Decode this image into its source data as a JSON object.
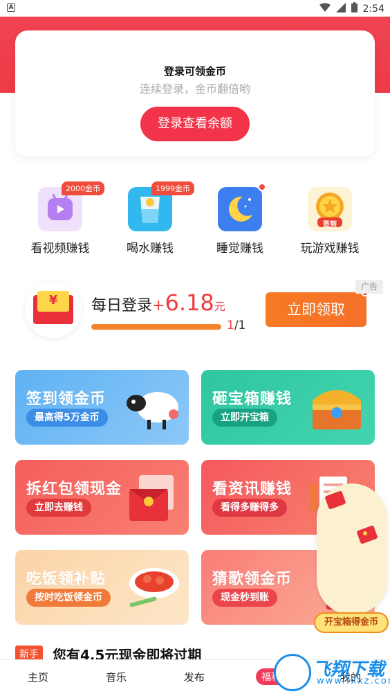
{
  "status_bar": {
    "time": "2:54",
    "left_icon": "A"
  },
  "login_card": {
    "title": "登录可领金币",
    "subtitle": "连续登录，金币翻倍哟",
    "button": "登录查看余额"
  },
  "quick_actions": [
    {
      "label": "看视频赚钱",
      "badge": "2000金币",
      "icon": "video-icon",
      "color": "#c9a2f5"
    },
    {
      "label": "喝水赚钱",
      "badge": "1999金币",
      "icon": "water-glass-icon",
      "color": "#4cc4f2"
    },
    {
      "label": "睡觉赚钱",
      "badge": "",
      "icon": "moon-icon",
      "color": "#4b83ee"
    },
    {
      "label": "玩游戏赚钱",
      "badge": "",
      "icon": "game-coin-icon",
      "color": "#f6a623",
      "icon_text": "签到"
    }
  ],
  "daily": {
    "title": "每日登录",
    "plus": "+",
    "amount": "6.18",
    "unit": "元",
    "progress_num": "1",
    "progress_den": "/1",
    "progress": 1.0,
    "button": "立即领取",
    "ad_tag": "广告",
    "envelope_symbol": "¥"
  },
  "cards": [
    {
      "title": "签到领金币",
      "sub": "最高得5万金币",
      "art": "sheep-icon"
    },
    {
      "title": "砸宝箱赚钱",
      "sub": "立即开宝箱",
      "art": "treasure-chest-icon"
    },
    {
      "title": "拆红包领现金",
      "sub": "立即去赚钱",
      "art": "red-envelope-icon"
    },
    {
      "title": "看资讯赚钱",
      "sub": "看得多赚得多",
      "art": "news-icon"
    },
    {
      "title": "吃饭领补贴",
      "sub": "按时吃饭领金币",
      "art": "food-plate-icon"
    },
    {
      "title": "猜歌领金币",
      "sub": "现金秒到账",
      "art": "gift-box-icon"
    }
  ],
  "floating": {
    "label": "开宝箱得金币"
  },
  "new_user": {
    "tag": "新手",
    "text": "您有4.5元现金即将过期"
  },
  "nav": [
    {
      "label": "主页"
    },
    {
      "label": "音乐"
    },
    {
      "label": "发布"
    },
    {
      "label": "福利"
    },
    {
      "label": "我的"
    }
  ],
  "watermark": {
    "title": "飞翔下载",
    "url": "www.fxxz.com"
  }
}
